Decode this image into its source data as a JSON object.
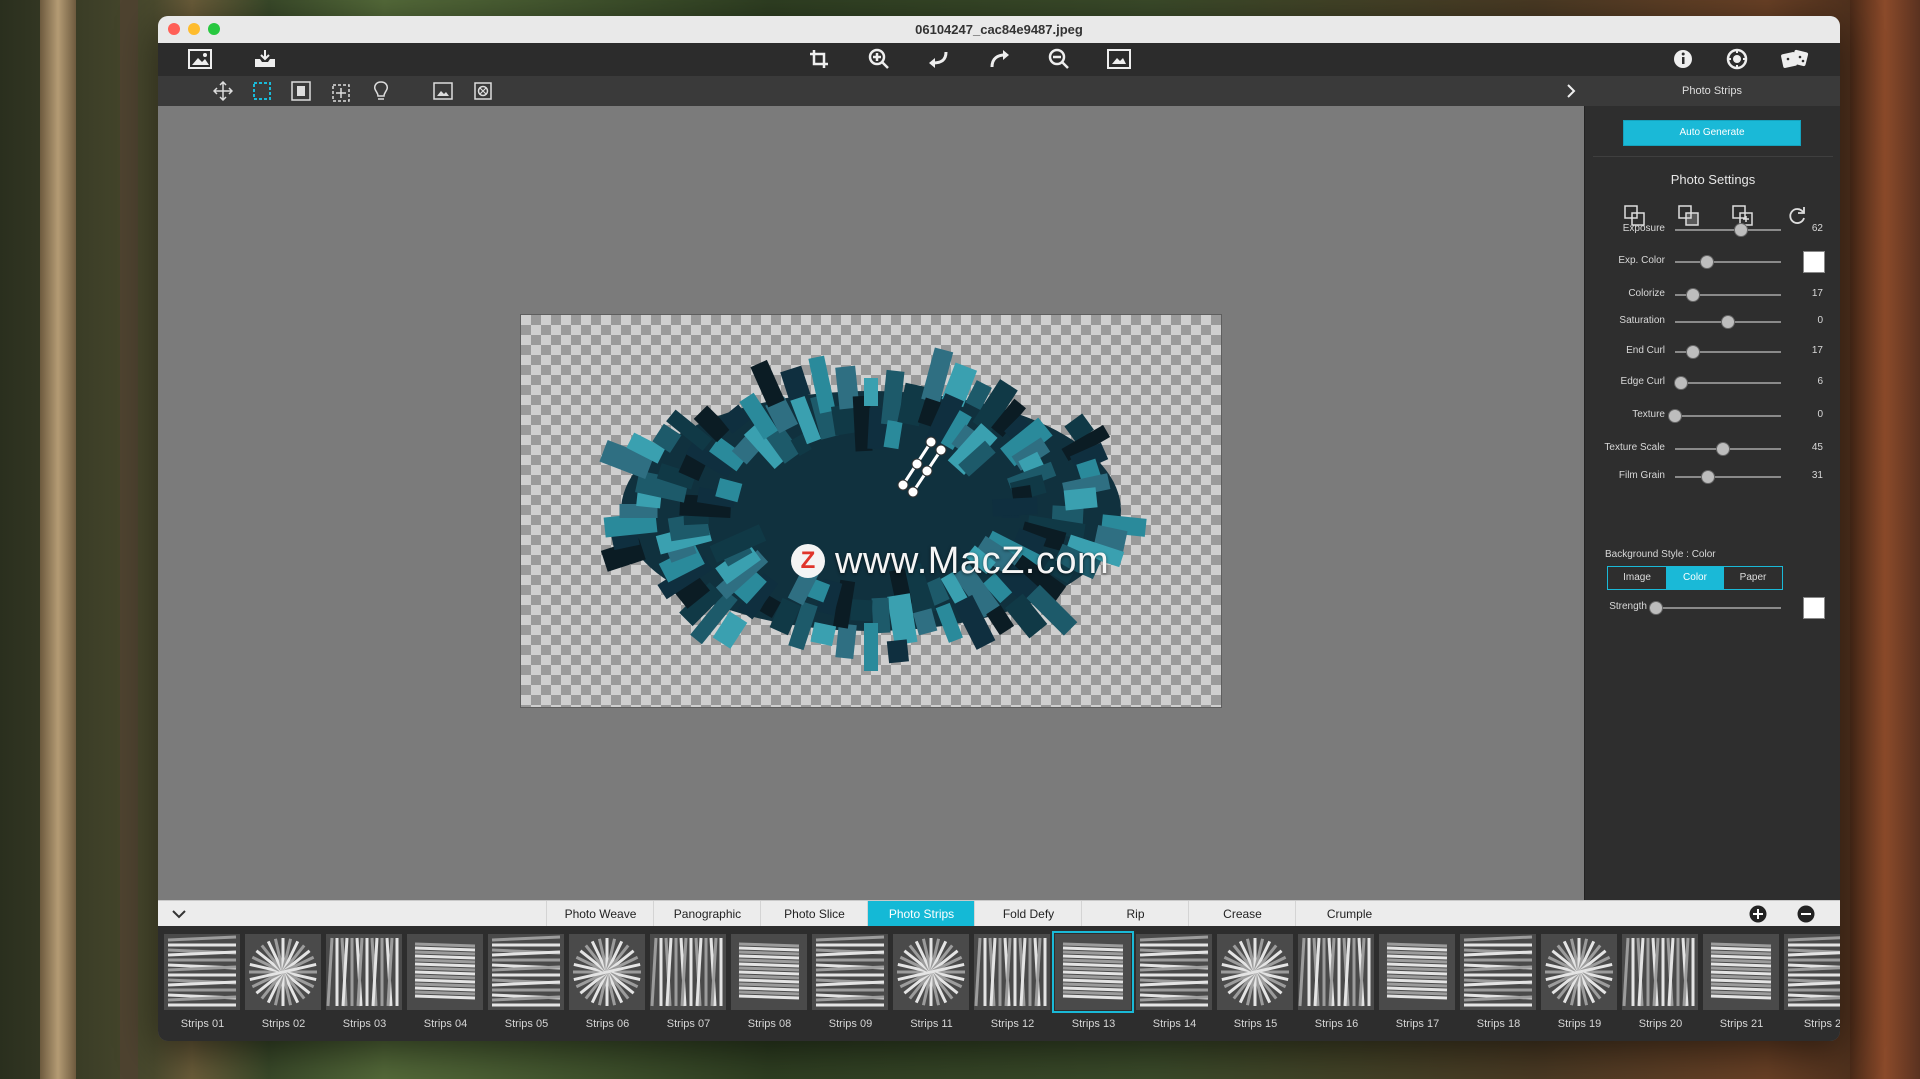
{
  "window": {
    "title": "06104247_cac84e9487.jpeg"
  },
  "toolbar": {
    "left_icons": [
      "open-image-icon",
      "save-export-icon"
    ],
    "center_icons": [
      "crop-icon",
      "zoom-in-icon",
      "undo-icon",
      "redo-icon",
      "zoom-out-icon",
      "fit-to-screen-icon"
    ],
    "right_icons": [
      "info-icon",
      "settings-icon",
      "dice-random-icon"
    ]
  },
  "subtoolbar": {
    "tools": [
      "move-tool-icon",
      "select-rectangle-icon",
      "fit-select-icon",
      "add-select-icon",
      "lightbulb-icon",
      "image-icon",
      "clear-icon"
    ]
  },
  "watermark": {
    "text": "www.MacZ.com",
    "logo_letter": "Z"
  },
  "panel": {
    "heading": "Photo Strips",
    "auto_generate": "Auto Generate",
    "section_title": "Photo Settings",
    "sliders": [
      {
        "label": "Exposure",
        "value": 62,
        "max": 100
      },
      {
        "label": "Exp. Color",
        "value": 30,
        "max": 100,
        "swatch": "#ffffff"
      },
      {
        "label": "Colorize",
        "value": 17,
        "max": 100
      },
      {
        "label": "Saturation",
        "value": 0,
        "max": 100,
        "center": true
      },
      {
        "label": "End Curl",
        "value": 17,
        "max": 100
      },
      {
        "label": "Edge Curl",
        "value": 6,
        "max": 100
      },
      {
        "label": "Texture",
        "value": 0,
        "max": 100
      },
      {
        "label": "Texture Scale",
        "value": 45,
        "max": 100
      },
      {
        "label": "Film Grain",
        "value": 31,
        "max": 100
      }
    ],
    "background_style_label": "Background Style : Color",
    "bg_options": [
      "Image",
      "Color",
      "Paper"
    ],
    "bg_selected": "Color",
    "strength": {
      "label": "Strength",
      "value": 0,
      "swatch": "#ffffff"
    }
  },
  "tabs": {
    "items": [
      "Photo Weave",
      "Panographic",
      "Photo Slice",
      "Photo Strips",
      "Fold Defy",
      "Rip",
      "Crease",
      "Crumple"
    ],
    "active": "Photo Strips"
  },
  "presets": {
    "items": [
      "Strips 01",
      "Strips 02",
      "Strips 03",
      "Strips 04",
      "Strips 05",
      "Strips 06",
      "Strips 07",
      "Strips 08",
      "Strips 09",
      "Strips 11",
      "Strips 12",
      "Strips 13",
      "Strips 14",
      "Strips 15",
      "Strips 16",
      "Strips 17",
      "Strips 18",
      "Strips 19",
      "Strips 20",
      "Strips 21",
      "Strips 2"
    ],
    "selected": "Strips 13"
  },
  "colors": {
    "accent": "#1ab9d7",
    "panel": "#2e2e2e",
    "canvas": "#7b7b7b"
  }
}
